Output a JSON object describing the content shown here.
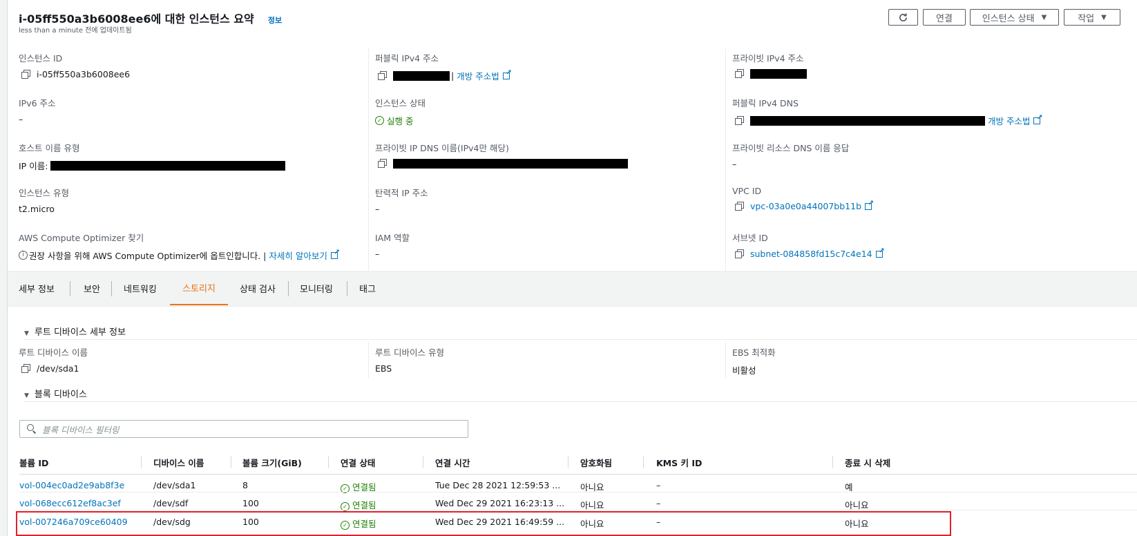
{
  "header": {
    "title": "i-05ff550a3b6008ee6에 대한 인스턴스 요약",
    "info_link": "정보",
    "subtitle": "less than a minute 전에 업데이트됨",
    "buttons": {
      "refresh_icon": "refresh-icon",
      "connect": "연결",
      "instance_state": "인스턴스 상태",
      "actions": "작업"
    }
  },
  "summary": {
    "instance_id": {
      "label": "인스턴스 ID",
      "value": "i-05ff550a3b6008ee6"
    },
    "ipv6": {
      "label": "IPv6 주소",
      "value": "–"
    },
    "hostname_type": {
      "label": "호스트 이름 유형",
      "prefix": "IP 이름:"
    },
    "instance_type": {
      "label": "인스턴스 유형",
      "value": "t2.micro"
    },
    "optimizer": {
      "label": "AWS Compute Optimizer 찾기",
      "text": "권장 사항을 위해 AWS Compute Optimizer에 옵트인합니다. |",
      "link": "자세히 알아보기"
    },
    "public_ipv4": {
      "label": "퍼블릭 IPv4 주소",
      "link": "개방 주소법"
    },
    "instance_state": {
      "label": "인스턴스 상태",
      "value": "실행 중"
    },
    "private_dns": {
      "label": "프라이빗 IP DNS 이름(IPv4만 해당)"
    },
    "elastic_ip": {
      "label": "탄력적 IP 주소",
      "value": "–"
    },
    "iam_role": {
      "label": "IAM 역할",
      "value": "–"
    },
    "private_ipv4": {
      "label": "프라이빗 IPv4 주소"
    },
    "public_dns": {
      "label": "퍼블릭 IPv4 DNS",
      "link": "개방 주소법"
    },
    "private_resource_dns": {
      "label": "프라이빗 리소스 DNS 이름 응답",
      "value": "–"
    },
    "vpc_id": {
      "label": "VPC ID",
      "value": "vpc-03a0e0a44007bb11b"
    },
    "subnet_id": {
      "label": "서브넷 ID",
      "value": "subnet-084858fd15c7c4e14"
    }
  },
  "tabs": [
    {
      "label": "세부 정보"
    },
    {
      "label": "보안"
    },
    {
      "label": "네트워킹"
    },
    {
      "label": "스토리지"
    },
    {
      "label": "상태 검사"
    },
    {
      "label": "모니터링"
    },
    {
      "label": "태그"
    }
  ],
  "active_tab": "스토리지",
  "root_device": {
    "section_title": "루트 디바이스 세부 정보",
    "name_label": "루트 디바이스 이름",
    "name_value": "/dev/sda1",
    "type_label": "루트 디바이스 유형",
    "type_value": "EBS",
    "ebs_label": "EBS 최적화",
    "ebs_value": "비활성"
  },
  "block_devices": {
    "section_title": "블록 디바이스",
    "filter_placeholder": "블록 디바이스 필터링",
    "columns": [
      "볼륨 ID",
      "디바이스 이름",
      "볼륨 크기(GiB)",
      "연결 상태",
      "연결 시간",
      "암호화됨",
      "KMS 키 ID",
      "종료 시 삭제"
    ],
    "rows": [
      {
        "volume_id": "vol-004ec0ad2e9ab8f3e",
        "device": "/dev/sda1",
        "size": "8",
        "status": "연결됨",
        "time": "Tue Dec 28 2021 12:59:53 ...",
        "encrypted": "아니요",
        "kms": "–",
        "delete": "예"
      },
      {
        "volume_id": "vol-068ecc612ef8ac3ef",
        "device": "/dev/sdf",
        "size": "100",
        "status": "연결됨",
        "time": "Wed Dec 29 2021 16:23:13 ...",
        "encrypted": "아니요",
        "kms": "–",
        "delete": "아니요"
      },
      {
        "volume_id": "vol-007246a709ce60409",
        "device": "/dev/sdg",
        "size": "100",
        "status": "연결됨",
        "time": "Wed Dec 29 2021 16:49:59 ...",
        "encrypted": "아니요",
        "kms": "–",
        "delete": "아니요"
      }
    ]
  },
  "colors": {
    "link": "#0073bb",
    "success": "#1d8102",
    "active_tab": "#ec7211",
    "highlight": "#e0202b"
  }
}
